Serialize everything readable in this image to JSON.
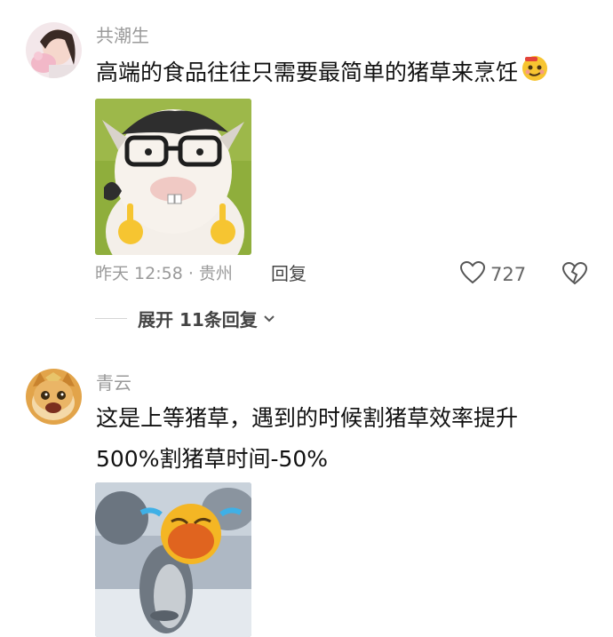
{
  "comments": [
    {
      "username": "共潮生",
      "text": "高端的食品往往只需要最简单的猪草来烹饪",
      "inline_emoji": "smirk-face-emoji",
      "image": "cow-with-glasses-sticker",
      "time_location": "昨天 12:58 · 贵州",
      "reply_label": "回复",
      "likes": "727",
      "replies_label": "展开 11条回复"
    },
    {
      "username": "青云",
      "text_line1": "这是上等猪草，遇到的时候割猪草效率提升",
      "text_line2": "500%割猪草时间-50%",
      "image": "laughing-crying-penguin-sticker"
    }
  ],
  "colors": {
    "username": "#9a9a9a",
    "text": "#111111",
    "meta": "#9a9a9a"
  }
}
